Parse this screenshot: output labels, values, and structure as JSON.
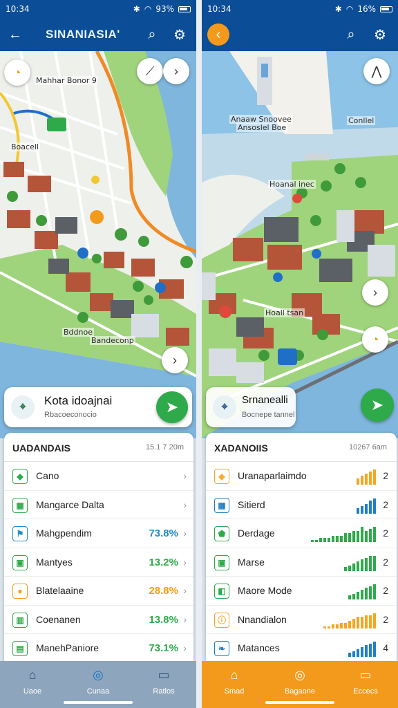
{
  "left": {
    "status": {
      "time": "10:34",
      "battery": "93%"
    },
    "appbar": {
      "title": "SINANIASIA'"
    },
    "map_labels": {
      "top": "Mahhar Bonor 9",
      "street": "Boacell",
      "bottom1": "Bddnoe",
      "bottom2": "Bandeconp"
    },
    "place": {
      "name": "Kota idoajnai",
      "sub": "Rbacoeconocio"
    },
    "panel": {
      "header": "UADANDAIS",
      "meta": "15.1 7 20m",
      "rows": [
        {
          "icon": "map-pin-icon",
          "label": "Cano",
          "value": "",
          "color": "#2eaa4a"
        },
        {
          "icon": "table-icon",
          "label": "Mangarce Dalta",
          "value": "",
          "color": "#2eaa4a"
        },
        {
          "icon": "flag-icon",
          "label": "Mahgpendim",
          "value": "73.8%",
          "color": "#1f8ec9"
        },
        {
          "icon": "calendar-icon",
          "label": "Mantyes",
          "value": "13.2%",
          "color": "#2eaa4a"
        },
        {
          "icon": "location-icon",
          "label": "Blatelaaine",
          "value": "28.8%",
          "color": "#f39a1d"
        },
        {
          "icon": "building-icon",
          "label": "Coenanen",
          "value": "13.8%",
          "color": "#2eaa4a"
        },
        {
          "icon": "document-icon",
          "label": "ManehPaniore",
          "value": "73.1%",
          "color": "#2eaa4a"
        }
      ]
    },
    "nav": [
      {
        "icon": "home-icon",
        "label": "Uaoe"
      },
      {
        "icon": "compass-icon",
        "label": "Cunaa"
      },
      {
        "icon": "folder-icon",
        "label": "Ratlos"
      }
    ]
  },
  "right": {
    "status": {
      "time": "10:34",
      "battery": "16%"
    },
    "map_labels": {
      "top1": "Anaaw Snoovee",
      "top2": "Ansoslel Boe",
      "top3": "Conllel",
      "harbor": "Hoanal inec",
      "mid": "Hoall tsan"
    },
    "place": {
      "name": "Srnanealli",
      "sub": "Bocnepe tannel"
    },
    "panel": {
      "header": "XADANOIIS",
      "meta": "10267 6am",
      "rows": [
        {
          "icon": "fuel-icon",
          "label": "Uranaparlaimdo",
          "num": "2",
          "bar_color": "#f5a623",
          "bars": [
            3,
            4,
            5,
            6,
            7
          ]
        },
        {
          "icon": "table-icon",
          "label": "Sitierd",
          "num": "2",
          "bar_color": "#1f7fc7",
          "bars": [
            3,
            4,
            5,
            7,
            8
          ]
        },
        {
          "icon": "shield-icon",
          "label": "Derdage",
          "num": "2",
          "bar_color": "#2eaa4a",
          "bars": [
            1,
            1,
            2,
            2,
            2,
            3,
            3,
            3,
            4,
            4,
            5,
            5,
            7,
            5,
            6,
            7
          ]
        },
        {
          "icon": "calendar-icon",
          "label": "Marse",
          "num": "2",
          "bar_color": "#2eaa4a",
          "bars": [
            2,
            3,
            4,
            5,
            6,
            7,
            8,
            8
          ]
        },
        {
          "icon": "car-icon",
          "label": "Maore Mode",
          "num": "2",
          "bar_color": "#2eaa4a",
          "bars": [
            2,
            3,
            4,
            5,
            6,
            7,
            8
          ]
        },
        {
          "icon": "info-icon",
          "label": "Nnandialon",
          "num": "2",
          "bar_color": "#f5a623",
          "bars": [
            1,
            1,
            2,
            2,
            3,
            3,
            4,
            5,
            6,
            6,
            7,
            7,
            8
          ]
        },
        {
          "icon": "leaf-icon",
          "label": "Matances",
          "num": "4",
          "bar_color": "#1f7fc7",
          "bars": [
            2,
            3,
            4,
            5,
            6,
            7,
            8
          ]
        }
      ]
    },
    "nav": [
      {
        "icon": "home-icon",
        "label": "Smad"
      },
      {
        "icon": "compass-icon",
        "label": "Bagaone"
      },
      {
        "icon": "folder-icon",
        "label": "Eccecs"
      }
    ]
  },
  "colors": {
    "primary": "#0b4d96",
    "accent_orange": "#f39a1d",
    "green": "#2eaa4a",
    "water": "#7fb6dd",
    "park": "#9fd47c"
  }
}
